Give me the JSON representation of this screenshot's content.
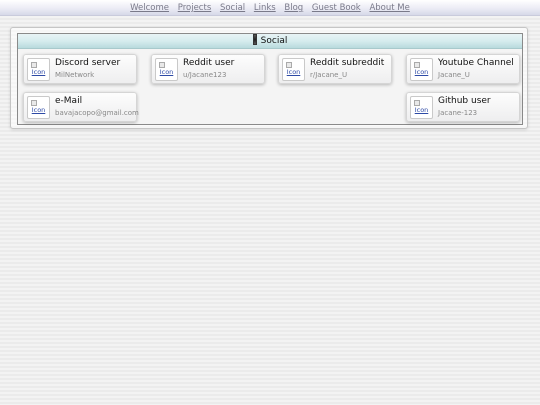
{
  "nav": {
    "items": [
      {
        "label": "Welcome"
      },
      {
        "label": "Projects"
      },
      {
        "label": "Social"
      },
      {
        "label": "Links"
      },
      {
        "label": "Blog"
      },
      {
        "label": "Guest Book"
      },
      {
        "label": "About Me"
      }
    ]
  },
  "panel": {
    "title": "Social"
  },
  "cards": [
    {
      "icon_alt": "Icon",
      "title": "Discord server",
      "subtitle": "MilNetwork"
    },
    {
      "icon_alt": "Icon",
      "title": "Reddit user",
      "subtitle": "u/Jacane123"
    },
    {
      "icon_alt": "Icon",
      "title": "Reddit subreddit",
      "subtitle": "r/Jacane_U"
    },
    {
      "icon_alt": "Icon",
      "title": "Youtube Channel",
      "subtitle": "Jacane_U"
    },
    {
      "icon_alt": "Icon",
      "title": "e-Mail",
      "subtitle": "bavajacopo@gmail.com"
    },
    {
      "icon_alt": "Icon",
      "title": "Github user",
      "subtitle": "Jacane-123"
    }
  ]
}
